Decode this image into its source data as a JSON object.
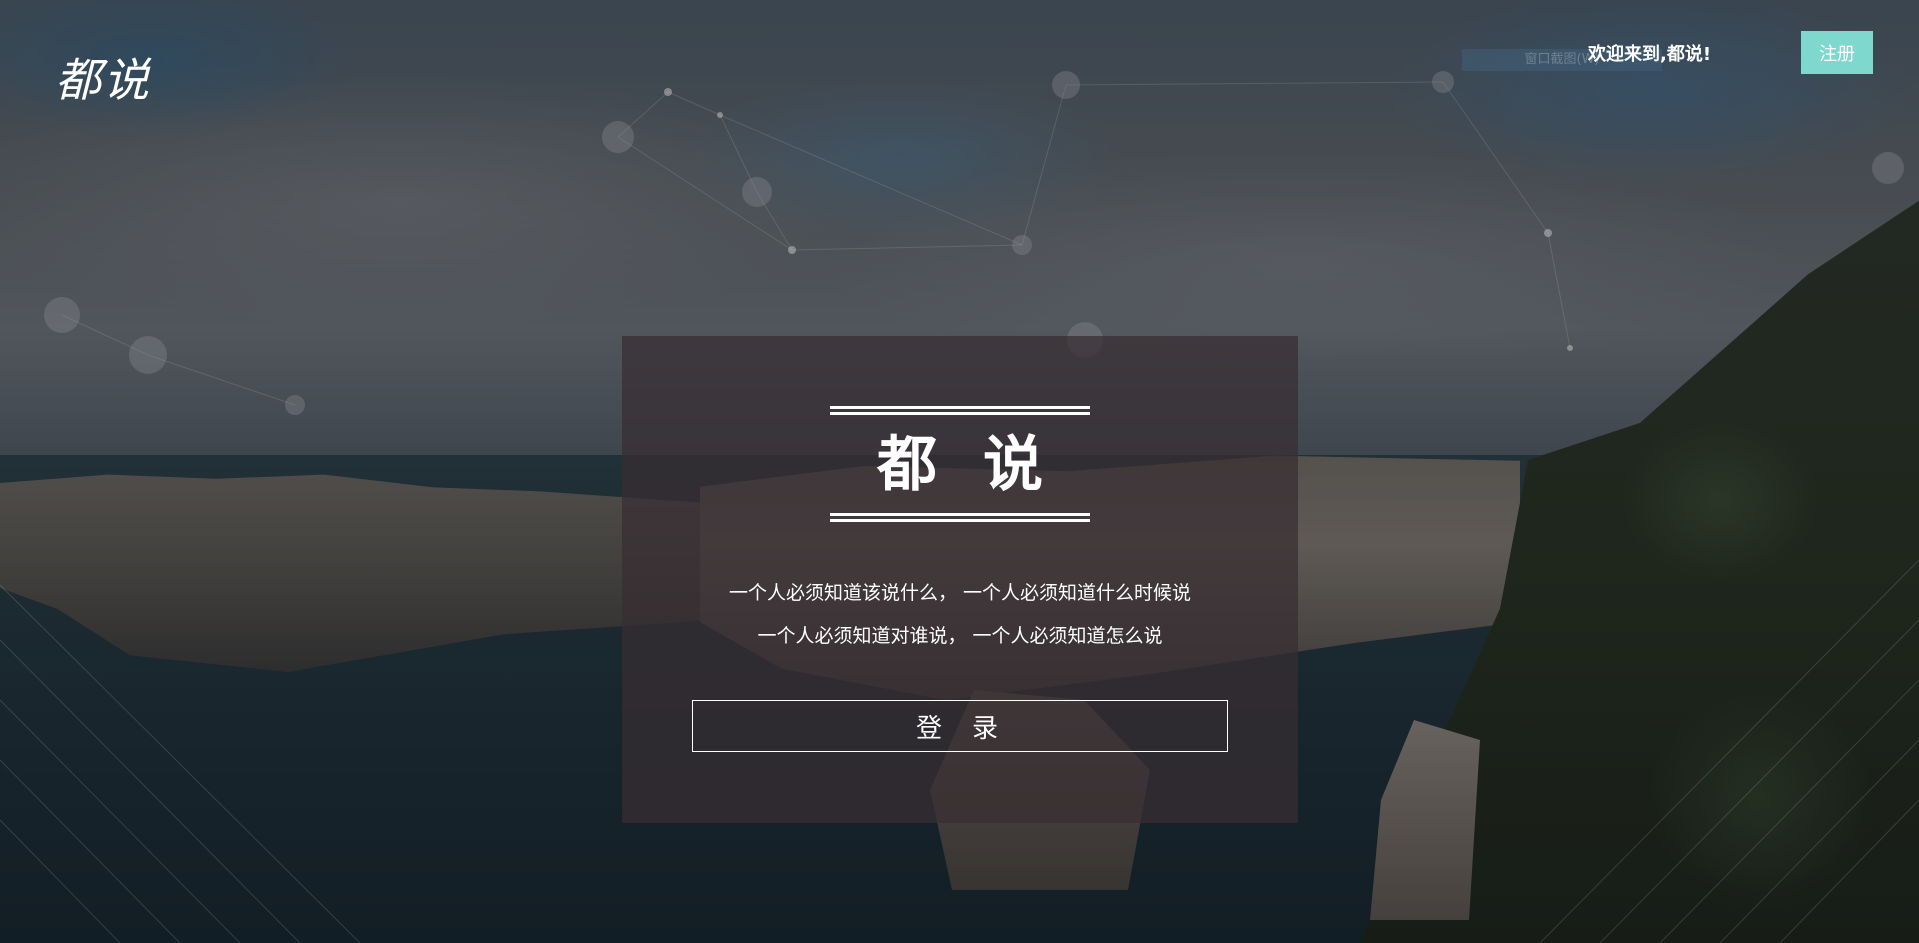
{
  "header": {
    "logo_text": "都说",
    "welcome_text": "欢迎来到,都说!",
    "register_label": "注册",
    "overlay_tag": "窗口截图(W)"
  },
  "hero": {
    "title": "都说",
    "tagline_line1": "一个人必须知道该说什么， 一个人必须知道什么时候说",
    "tagline_line2": "一个人必须知道对谁说， 一个人必须知道怎么说",
    "login_label": "登录"
  },
  "colors": {
    "accent": "#7fd8cd",
    "panel_bg": "rgba(56,46,50,0.72)",
    "text": "#ffffff"
  }
}
